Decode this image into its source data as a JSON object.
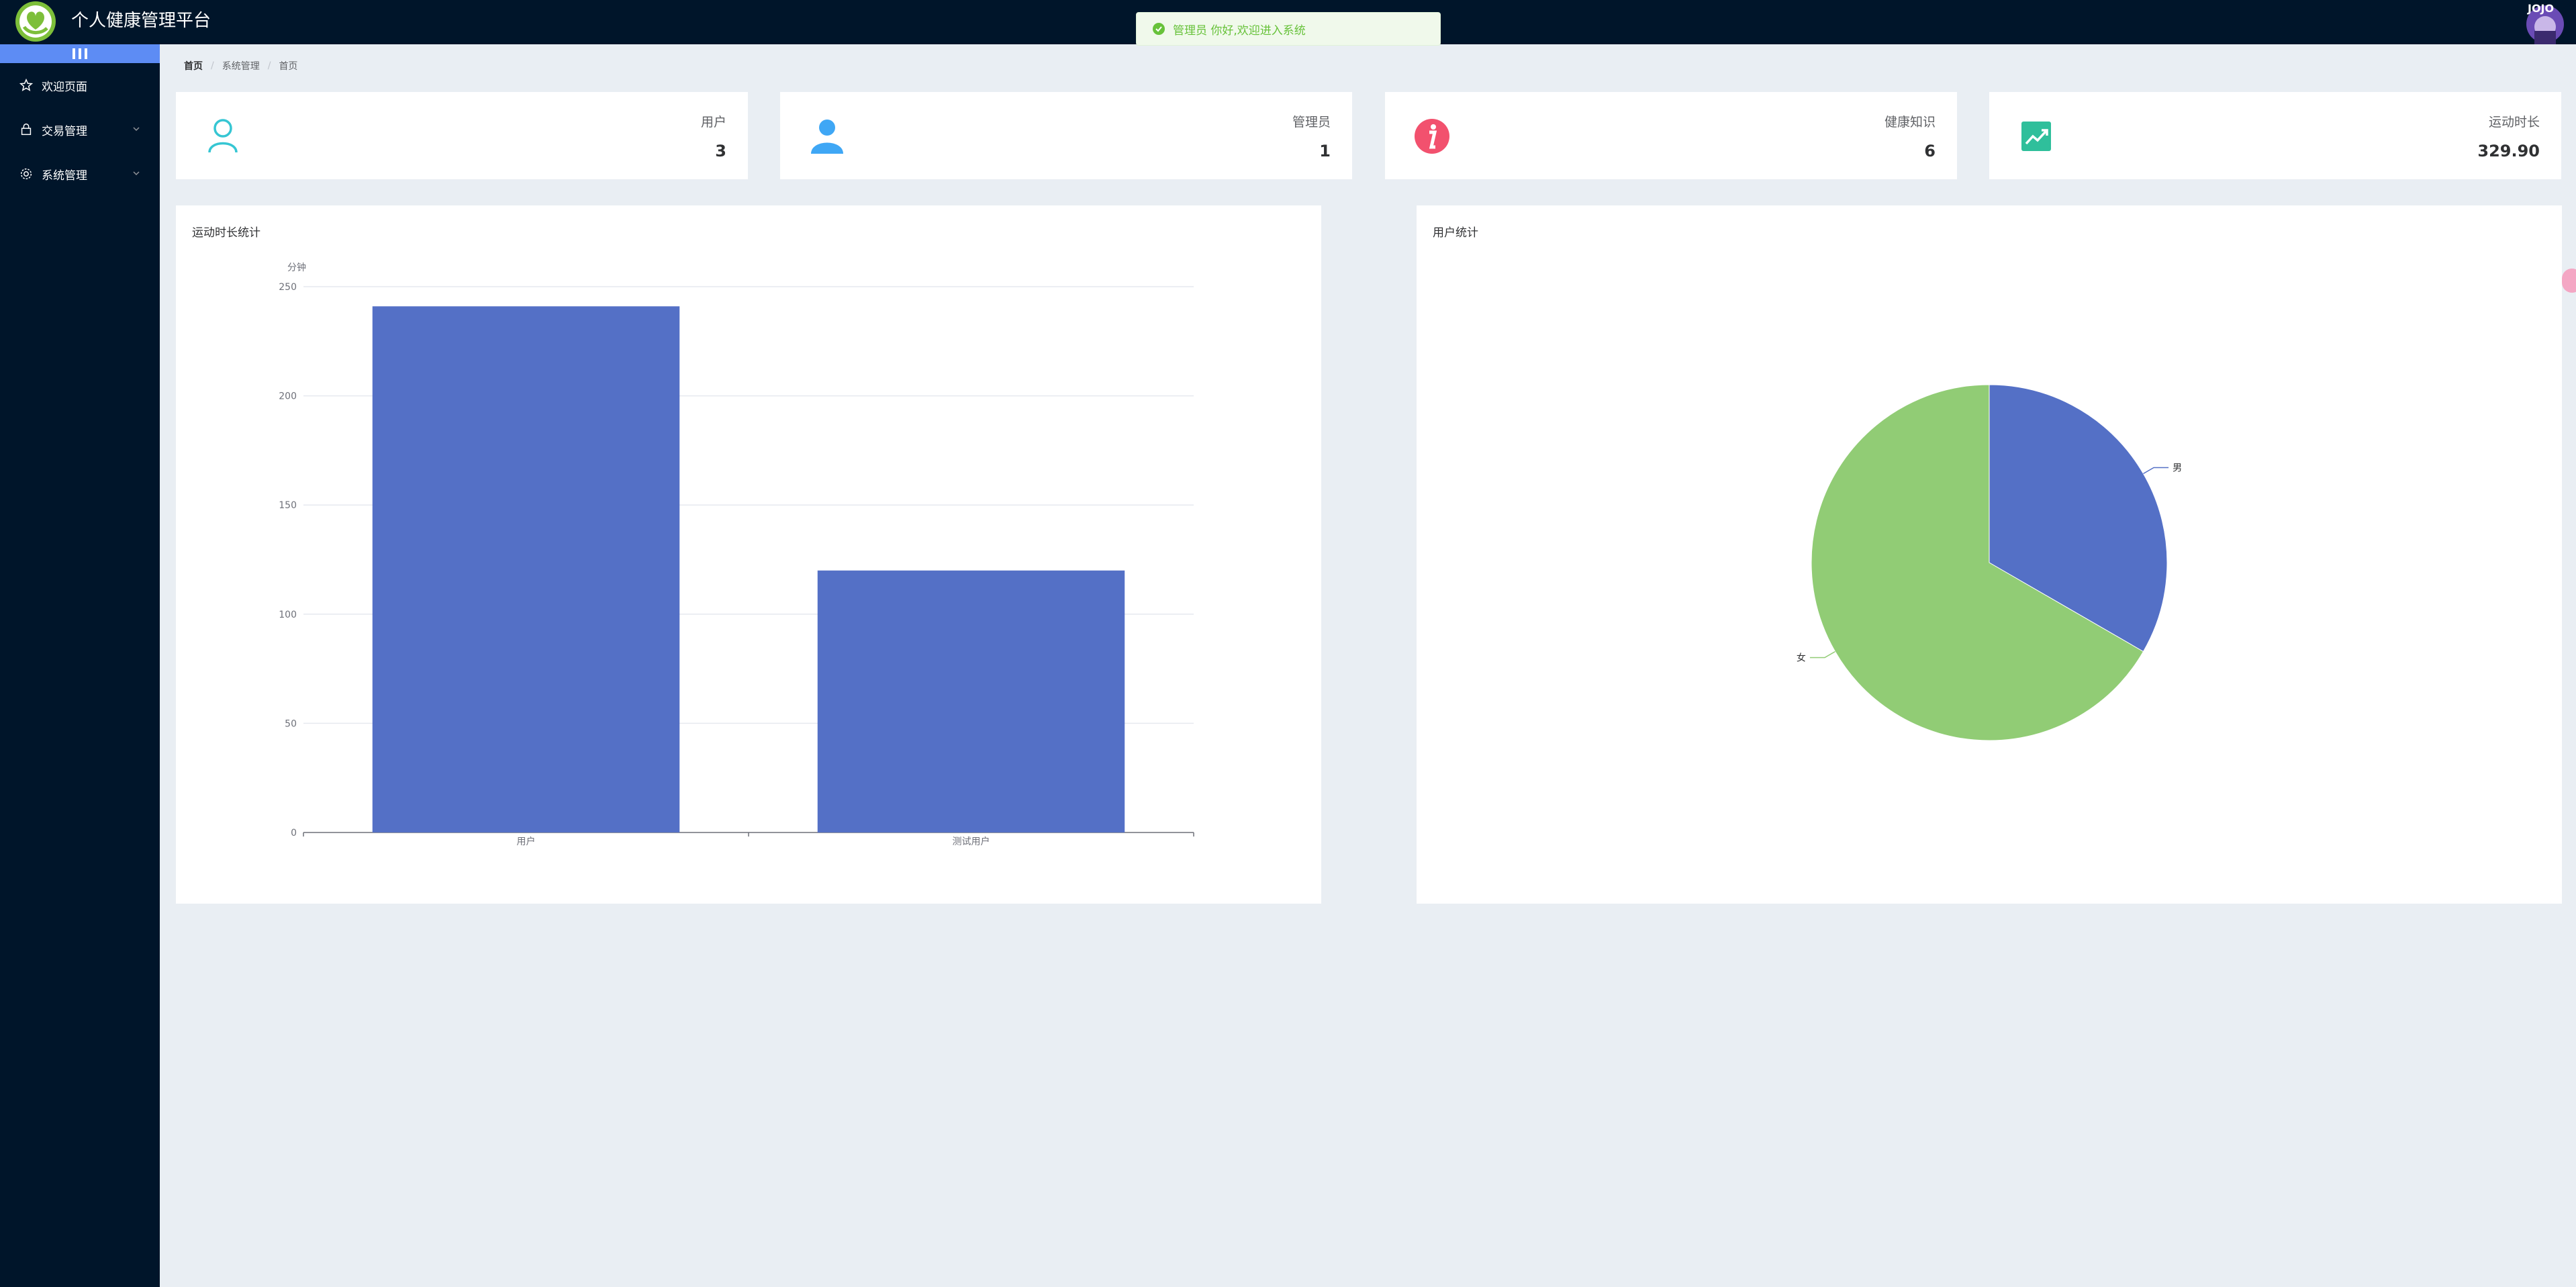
{
  "header": {
    "title": "个人健康管理平台",
    "avatar_text": "JOJO"
  },
  "toast": {
    "message": "管理员 你好,欢迎进入系统"
  },
  "sidebar": {
    "items": [
      {
        "label": "欢迎页面",
        "icon": "star-icon"
      },
      {
        "label": "交易管理",
        "icon": "lock-icon",
        "expandable": true
      },
      {
        "label": "系统管理",
        "icon": "gear-icon",
        "expandable": true
      }
    ]
  },
  "breadcrumb": [
    "首页",
    "系统管理",
    "首页"
  ],
  "stats": [
    {
      "label": "用户",
      "value": "3",
      "icon": "user-outline-icon",
      "color": "#36c6d3"
    },
    {
      "label": "管理员",
      "value": "1",
      "icon": "user-filled-icon",
      "color": "#3fa7f5"
    },
    {
      "label": "健康知识",
      "value": "6",
      "icon": "info-icon",
      "color": "#f2516e"
    },
    {
      "label": "运动时长",
      "value": "329.90",
      "icon": "trend-icon",
      "color": "#2fbf9b"
    }
  ],
  "bar_panel": {
    "title": "运动时长统计"
  },
  "pie_panel": {
    "title": "用户统计"
  },
  "chart_data": [
    {
      "type": "bar",
      "title": "运动时长统计",
      "ylabel": "分钟",
      "categories": [
        "用户",
        "测试用户"
      ],
      "values": [
        241,
        120
      ],
      "ylim": [
        0,
        250
      ],
      "yticks": [
        0,
        50,
        100,
        150,
        200,
        250
      ],
      "color": "#5470c6",
      "grid": true
    },
    {
      "type": "pie",
      "title": "用户统计",
      "slices": [
        {
          "label": "男",
          "value": 1,
          "color": "#5470c6"
        },
        {
          "label": "女",
          "value": 2,
          "color": "#91cc75"
        }
      ]
    }
  ]
}
